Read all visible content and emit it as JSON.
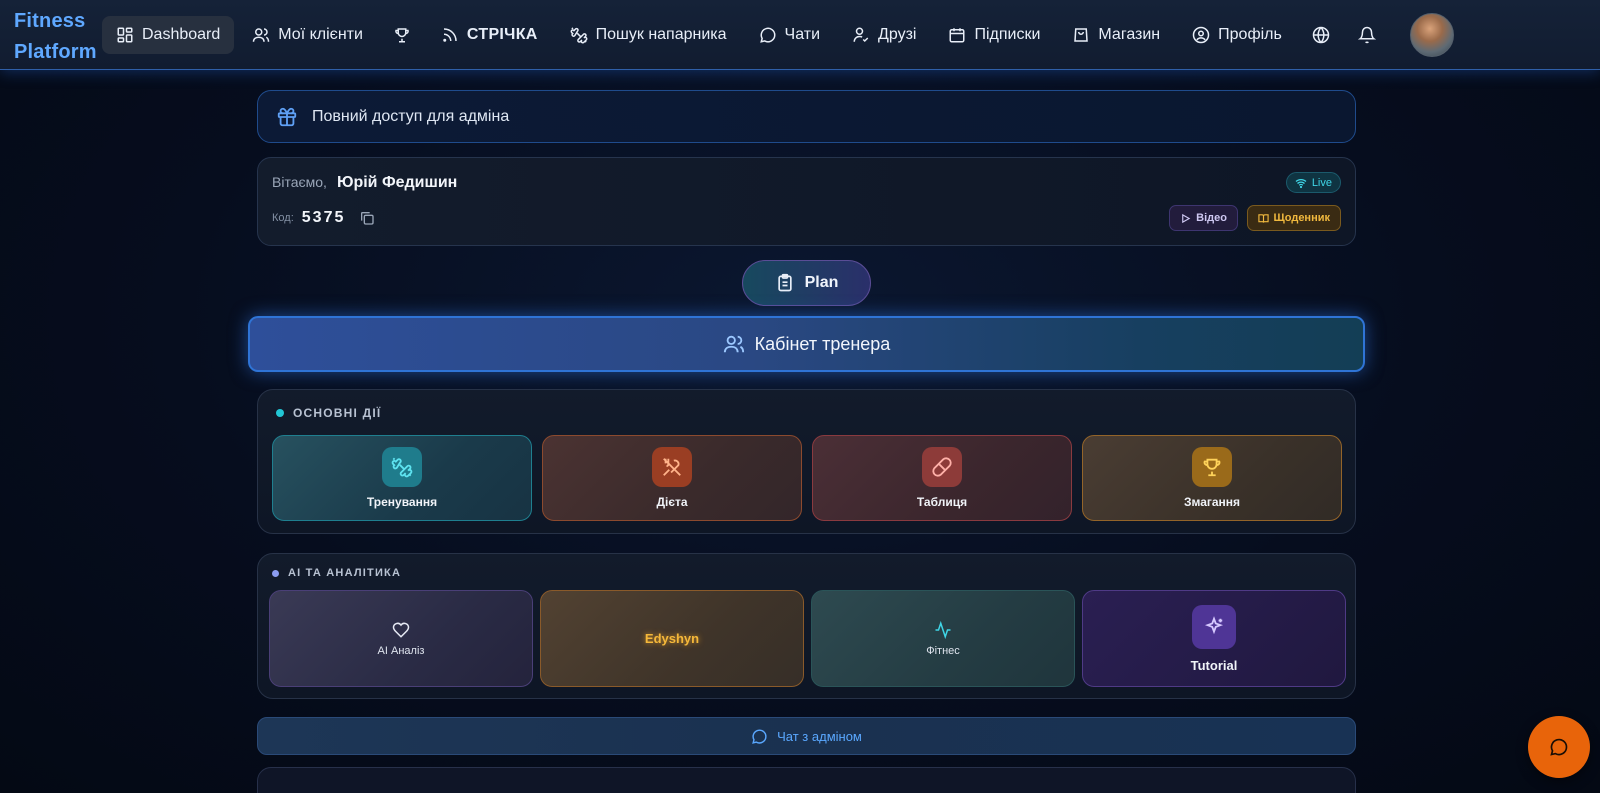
{
  "brand": {
    "name": "Fitness Platform"
  },
  "nav": {
    "dashboard": "Dashboard",
    "clients": "Мої клієнти",
    "feed": "СТРІЧКА",
    "partner": "Пошук напарника",
    "chats": "Чати",
    "friends": "Друзі",
    "subscriptions": "Підписки",
    "shop": "Магазин",
    "profile": "Профіль"
  },
  "icons": {
    "dashboard": "grid-icon",
    "clients": "users-icon",
    "trophy": "trophy-icon",
    "feed": "rss-icon",
    "partner": "dumbbell-icon",
    "chats": "chat-bubble-icon",
    "friends": "user-check-icon",
    "subscriptions": "calendar-icon",
    "shop": "shopping-bag-icon",
    "profile": "user-circle-icon",
    "language": "globe-icon",
    "notifications": "bell-icon"
  },
  "admin_banner": {
    "text": "Повний доступ для адміна"
  },
  "welcome": {
    "greeting_label": "Вітаємо,",
    "user_name": "Юрій Федишин",
    "code_label": "Код:",
    "code_value": "5375",
    "live_badge": "Live",
    "video_label": "Відео",
    "diary_label": "Щоденник"
  },
  "plan_button": {
    "label": "Plan"
  },
  "cabinet_button": {
    "label": "Кабінет тренера"
  },
  "main_actions": {
    "title": "ОСНОВНІ ДІЇ",
    "dot_color": "#22c7d6",
    "tiles": [
      {
        "label": "Тренування",
        "icon": "dumbbell-icon"
      },
      {
        "label": "Дієта",
        "icon": "utensils-icon"
      },
      {
        "label": "Таблиця",
        "icon": "pill-icon"
      },
      {
        "label": "Змагання",
        "icon": "trophy-icon"
      }
    ]
  },
  "ai_section": {
    "title": "AI ТА АНАЛІТИКА",
    "dot_color": "#8b9cf0",
    "tiles": [
      {
        "label": "AI Аналіз",
        "icon": "heart-icon"
      },
      {
        "label": "Edyshyn"
      },
      {
        "label": "Фітнес",
        "icon": "activity-icon"
      },
      {
        "label": "Tutorial",
        "icon": "sparkles-icon"
      }
    ]
  },
  "admin_chat": {
    "label": "Чат з адміном"
  },
  "colors": {
    "accent_blue": "#2f74d6",
    "fab_orange": "#e8640a",
    "live_cyan": "#3fd5e6",
    "diary_gold": "#f1b93e"
  }
}
